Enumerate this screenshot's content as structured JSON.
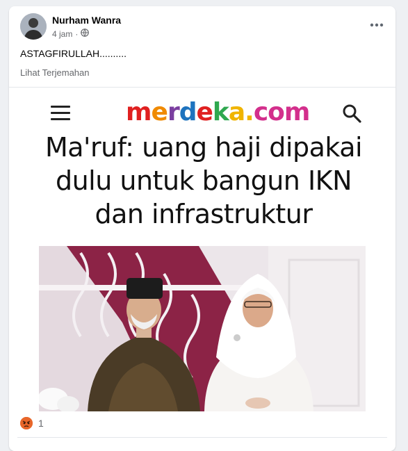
{
  "post": {
    "author": "Nurham Wanra",
    "time": "4 jam",
    "visibility_icon": "globe-icon",
    "text": "ASTAGFIRULLAH..........",
    "see_translation": "Lihat Terjemahan",
    "more_icon": "more-options-icon"
  },
  "article": {
    "site_name": [
      "m",
      "e",
      "r",
      "d",
      "e",
      "k",
      "a",
      ".",
      "com"
    ],
    "headline": "Ma'ruf: uang haji dipakai dulu untuk bangun IKN dan infrastruktur"
  },
  "reactions": {
    "type": "angry-reaction-icon",
    "count": "1"
  },
  "colors": {
    "logo_red": "#e02020",
    "logo_orange": "#f08a00",
    "logo_purple": "#7b3fa0",
    "logo_blue": "#1e73be",
    "logo_green": "#2fa84f",
    "logo_yellow": "#f0b400",
    "logo_pink": "#d32f8c",
    "angry_reaction": "#ec7a2c"
  }
}
